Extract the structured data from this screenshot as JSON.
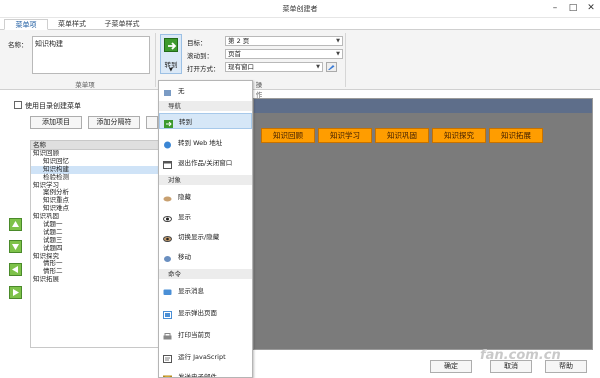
{
  "window": {
    "title": "菜单创建者"
  },
  "tabs": [
    "菜单项",
    "菜单样式",
    "子菜单样式"
  ],
  "ribbon": {
    "name_label": "名称：",
    "name_value": "知识构建",
    "group_menu_item": "菜单项",
    "goto_button": "转到",
    "target_label": "目标：",
    "target_value": "第 2 页",
    "scroll_label": "滚动到：",
    "scroll_value": "页首",
    "open_label": "打开方式：",
    "open_value": "现有窗口",
    "group_action": "操作"
  },
  "left": {
    "use_dir_label": "使用目录创建菜单",
    "add_item": "添加项目",
    "add_separator": "添加分隔符",
    "tree_header": "名称",
    "tree_rows": [
      {
        "label": "知识回顾",
        "indent": 0,
        "selected": false
      },
      {
        "label": "知识回忆",
        "indent": 1,
        "selected": false
      },
      {
        "label": "知识构建",
        "indent": 1,
        "selected": true
      },
      {
        "label": "检验检测",
        "indent": 1,
        "selected": false
      },
      {
        "label": "知识学习",
        "indent": 0,
        "selected": false
      },
      {
        "label": "案例分析",
        "indent": 1,
        "selected": false
      },
      {
        "label": "知识重点",
        "indent": 1,
        "selected": false
      },
      {
        "label": "知识难点",
        "indent": 1,
        "selected": false
      },
      {
        "label": "知识巩固",
        "indent": 0,
        "selected": false
      },
      {
        "label": "试题一",
        "indent": 1,
        "selected": false
      },
      {
        "label": "试题二",
        "indent": 1,
        "selected": false
      },
      {
        "label": "试题三",
        "indent": 1,
        "selected": false
      },
      {
        "label": "试题四",
        "indent": 1,
        "selected": false
      },
      {
        "label": "知识探究",
        "indent": 0,
        "selected": false
      },
      {
        "label": "情形一",
        "indent": 1,
        "selected": false
      },
      {
        "label": "情形二",
        "indent": 1,
        "selected": false
      },
      {
        "label": "知识拓展",
        "indent": 0,
        "selected": false
      }
    ]
  },
  "dropdown": {
    "none": "无",
    "nav_header": "导航",
    "goto": "转到",
    "goto_web": "转到 Web 地址",
    "exit": "退出作品/关闭窗口",
    "object_header": "对象",
    "hide": "隐藏",
    "show": "显示",
    "toggle": "切换显示/隐藏",
    "move": "移动",
    "command_header": "命令",
    "show_message": "显示消息",
    "show_popup": "显示弹出页面",
    "print": "打印当前页",
    "run_js": "运行 JavaScript",
    "send_email": "发送电子邮件"
  },
  "preview": {
    "menu_items": [
      "知识回顾",
      "知识学习",
      "知识巩固",
      "知识探究",
      "知识拓展"
    ]
  },
  "bottom": {
    "ok": "确定",
    "cancel": "取消",
    "help": "帮助"
  },
  "watermark": "fan.com.cn",
  "colors": {
    "accent": "#1a5aa0",
    "preview_button": "#ff9d00",
    "preview_bg": "#7b7b7b",
    "arrow_green": "#7ec24a"
  }
}
